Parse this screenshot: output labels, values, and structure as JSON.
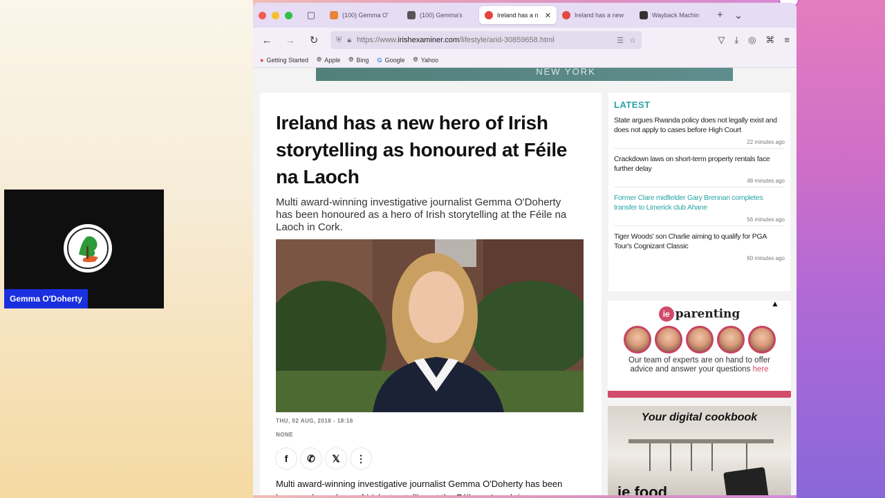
{
  "video": {
    "participant_name": "Gemma O'Doherty"
  },
  "browser": {
    "tabs": [
      {
        "label": "(100) Gemma O'",
        "color": "#e8833a",
        "active": false
      },
      {
        "label": "(100) Gemma's",
        "color": "#555555",
        "active": false
      },
      {
        "label": "Ireland has a n",
        "color": "#e2473d",
        "active": true
      },
      {
        "label": "Ireland has a new",
        "color": "#e2473d",
        "active": false
      },
      {
        "label": "Wayback Machin",
        "color": "#333333",
        "active": false
      }
    ],
    "url_prefix": "https://www.",
    "url_domain": "irishexaminer.com",
    "url_path": "/lifestyle/arid-30859658.html",
    "bookmarks": [
      "Getting Started",
      "Apple",
      "Bing",
      "Google",
      "Yahoo"
    ]
  },
  "banner": {
    "text": "NEW YORK"
  },
  "article": {
    "headline": "Ireland has a new hero of Irish storytelling as honoured at Féile na Laoch",
    "standfirst": "Multi award-winning investigative journalist Gemma O'Doherty has been honoured as a hero of Irish storytelling at the Féile na Laoch in Cork.",
    "date": "THU, 02 AUG, 2018 - 18:16",
    "tag": "NONE",
    "body": "Multi award-winning investigative journalist Gemma O'Doherty has been honoured as a hero of Irish storytelling at the Féile na Laoch in"
  },
  "latest": {
    "title": "LATEST",
    "items": [
      {
        "headline": "State argues Rwanda policy does not legally exist and does not apply to cases before High Court",
        "time": "22 minutes ago",
        "highlight": false
      },
      {
        "headline": "Crackdown laws on short-term property rentals face further delay",
        "time": "48 minutes ago",
        "highlight": false
      },
      {
        "headline": "Former Clare midfielder Gary Brennan completes transfer to Limerick club Ahane",
        "time": "56 minutes ago",
        "highlight": true
      },
      {
        "headline": "Tiger Woods' son Charlie aiming to qualify for PGA Tour's Cognizant Classic",
        "time": "60 minutes ago",
        "highlight": false
      }
    ]
  },
  "parenting": {
    "logo_badge": "ie",
    "logo_text": "parenting",
    "text": "Our team of experts are on hand to offer advice and answer your questions",
    "link": "here"
  },
  "cookbook": {
    "title": "Your digital cookbook",
    "logo": "ie food"
  }
}
